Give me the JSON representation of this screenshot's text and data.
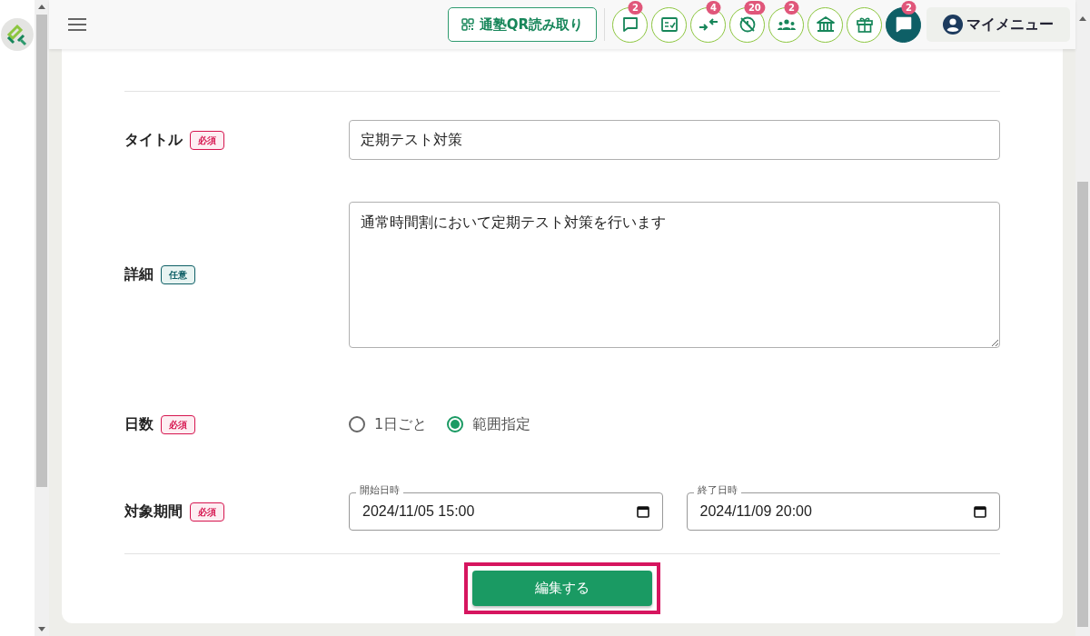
{
  "header": {
    "qr_button": "通塾QR読み取り",
    "icon_buttons": [
      {
        "kind": "chat",
        "badge": "2",
        "filled": false
      },
      {
        "kind": "checklist",
        "filled": false
      },
      {
        "kind": "arrows",
        "badge": "4",
        "filled": false
      },
      {
        "kind": "no-clock",
        "badge": "20",
        "filled": false
      },
      {
        "kind": "group",
        "badge": "2",
        "filled": false
      },
      {
        "kind": "bank",
        "filled": false
      },
      {
        "kind": "gift",
        "filled": false
      },
      {
        "kind": "chat",
        "badge": "2",
        "filled": true
      }
    ],
    "my_menu": "マイメニュー"
  },
  "form": {
    "rows": [
      {
        "kind": "text",
        "label": "タイトル",
        "tag": "必須",
        "required": true,
        "value": "定期テスト対策"
      },
      {
        "kind": "textarea",
        "label": "詳細",
        "tag": "任意",
        "required": false,
        "value": "通常時間割において定期テスト対策を行います"
      },
      {
        "kind": "radio",
        "label": "日数",
        "tag": "必須",
        "required": true,
        "options": [
          {
            "label": "1日ごと",
            "selected": false
          },
          {
            "label": "範囲指定",
            "selected": true
          }
        ]
      },
      {
        "kind": "dates",
        "label": "対象期間",
        "tag": "必須",
        "required": true,
        "fields": [
          {
            "label": "開始日時",
            "value": "2024/11/05 15:00"
          },
          {
            "label": "終了日時",
            "value": "2024/11/09 20:00"
          }
        ]
      }
    ],
    "submit": {
      "label": "編集する",
      "highlighted": true
    }
  }
}
